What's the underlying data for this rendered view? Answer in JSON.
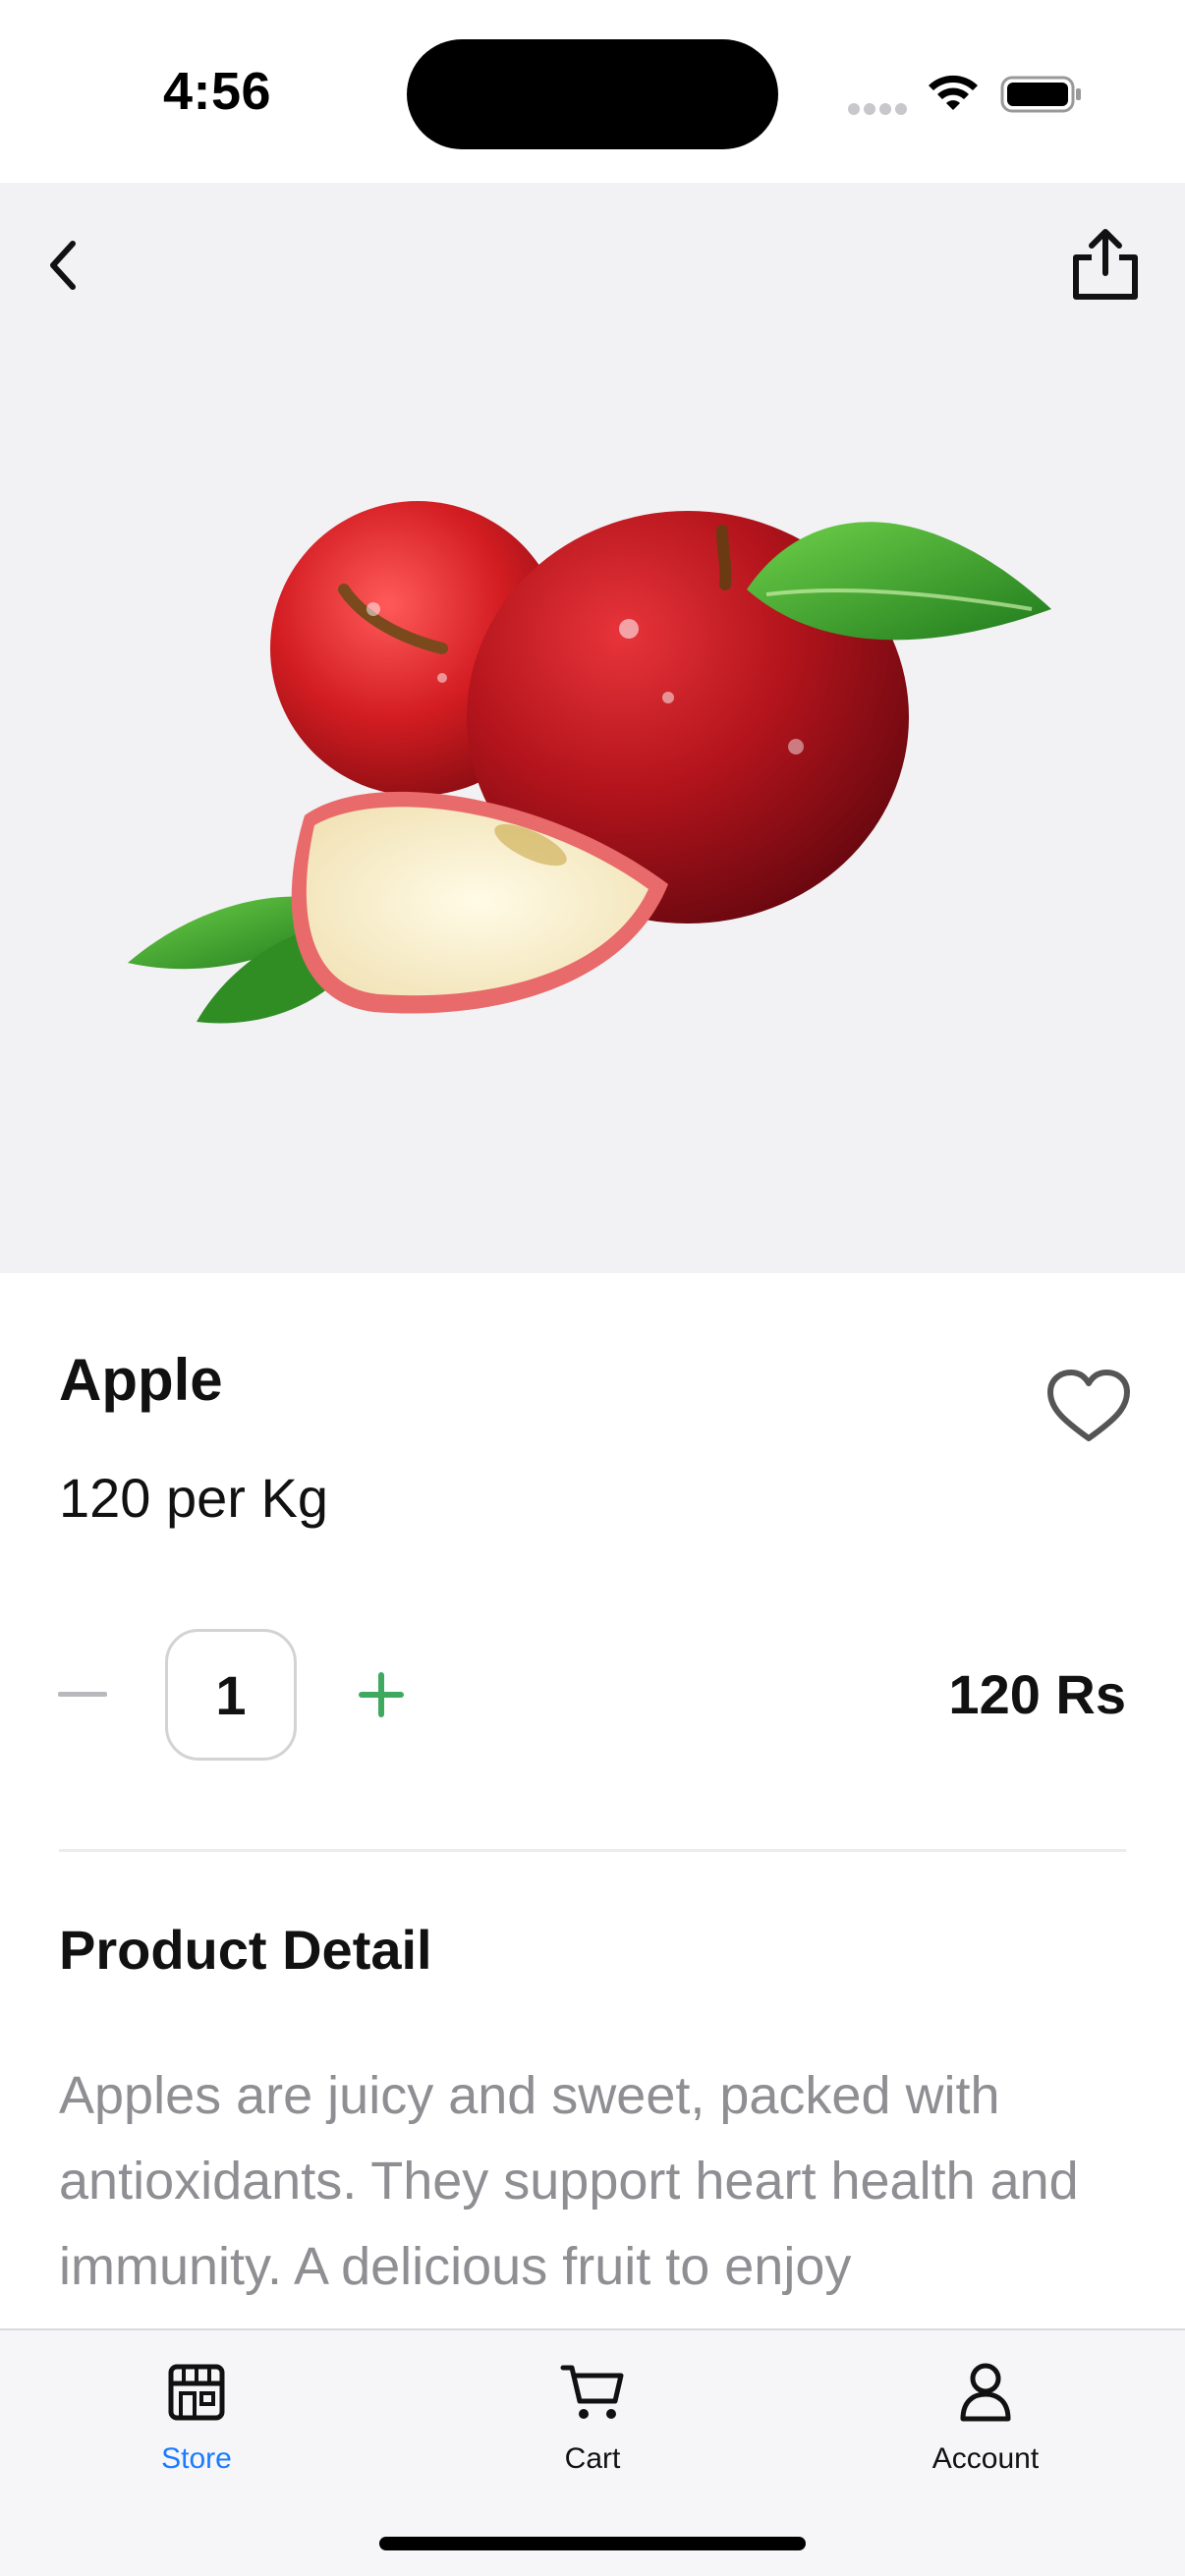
{
  "status_bar": {
    "time": "4:56"
  },
  "product": {
    "name": "Apple",
    "unit_price": "120 per Kg",
    "quantity": "1",
    "total_price": "120 Rs",
    "image_icon": "apple-illustration"
  },
  "detail": {
    "title": "Product Detail",
    "description": "Apples are juicy and sweet, packed with antioxidants. They support heart health and immunity. A delicious fruit to enjoy"
  },
  "tab_bar": {
    "items": [
      {
        "label": "Store",
        "icon": "store-icon",
        "active": true
      },
      {
        "label": "Cart",
        "icon": "cart-icon",
        "active": false
      },
      {
        "label": "Account",
        "icon": "account-icon",
        "active": false
      }
    ]
  },
  "colors": {
    "accent_active_tab": "#1a7cff",
    "plus_green": "#3faa5f",
    "minus_gray": "#b9b9bd",
    "hero_background": "#f2f2f4",
    "description_gray": "#8e8e93"
  }
}
